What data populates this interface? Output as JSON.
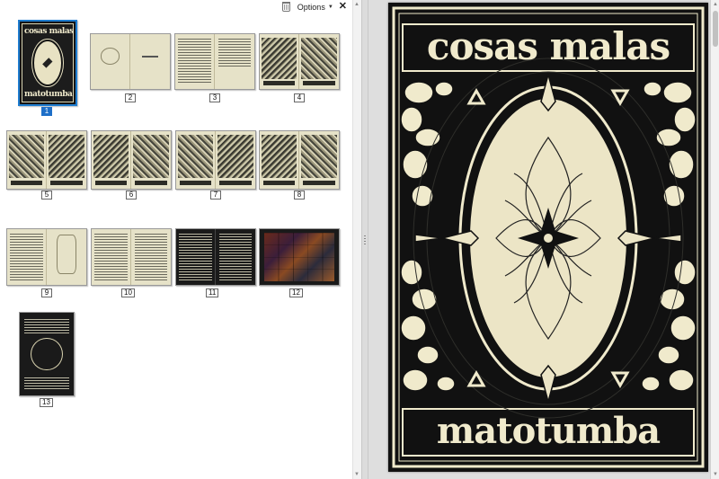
{
  "toolbar": {
    "options_label": "Options",
    "close_glyph": "✕",
    "delete_icon": "trash-icon"
  },
  "thumbnails": [
    {
      "label": "1",
      "kind": "cover",
      "selected": true
    },
    {
      "label": "2",
      "kind": "spread-title"
    },
    {
      "label": "3",
      "kind": "spread-text"
    },
    {
      "label": "4",
      "kind": "spread-illustration"
    },
    {
      "label": "5",
      "kind": "spread-illustration"
    },
    {
      "label": "6",
      "kind": "spread-illustration"
    },
    {
      "label": "7",
      "kind": "spread-illustration"
    },
    {
      "label": "8",
      "kind": "spread-illustration"
    },
    {
      "label": "9",
      "kind": "spread-text"
    },
    {
      "label": "10",
      "kind": "spread-text"
    },
    {
      "label": "11",
      "kind": "spread-text-dark"
    },
    {
      "label": "12",
      "kind": "spread-photos"
    },
    {
      "label": "13",
      "kind": "back-cover"
    }
  ],
  "cover": {
    "title_top": "cosas malas",
    "title_bottom": "matotumba",
    "thumb_title_top": "cosas malas",
    "thumb_title_bottom": "matotumba",
    "colors": {
      "ink": "#111111",
      "paper": "#f0eacc"
    }
  },
  "selection_color": "#1e6fc8"
}
